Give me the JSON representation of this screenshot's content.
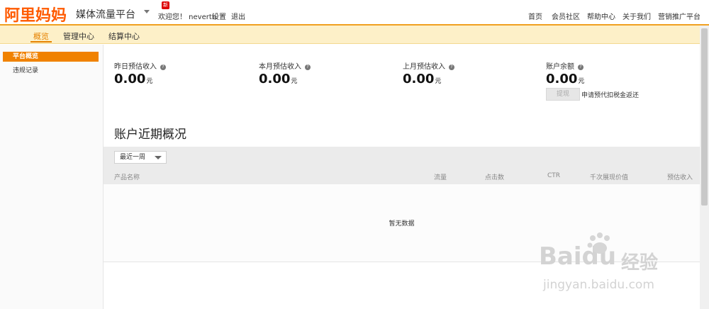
{
  "brand": {
    "logo": "阿里妈妈",
    "platform": "媒体流量平台",
    "badge": "新"
  },
  "user": {
    "welcome": "欢迎您！ neverth",
    "settings": "设置",
    "logout": "退出"
  },
  "top_links": [
    "首页",
    "会员社区",
    "帮助中心",
    "关于我们",
    "营销推广平台"
  ],
  "tabs": [
    "概览",
    "管理中心",
    "结算中心"
  ],
  "sidebar": {
    "items": [
      "平台概览",
      "违规记录"
    ]
  },
  "stats": [
    {
      "label": "昨日预估收入",
      "value": "0.00",
      "unit": "元"
    },
    {
      "label": "本月预估收入",
      "value": "0.00",
      "unit": "元"
    },
    {
      "label": "上月预估收入",
      "value": "0.00",
      "unit": "元"
    },
    {
      "label": "账户余额",
      "value": "0.00",
      "unit": "元"
    }
  ],
  "withdraw": {
    "button": "提现",
    "note": "申请预代扣税金返还"
  },
  "recent": {
    "title": "账户近期概况",
    "period": "最近一周",
    "columns": [
      "产品名称",
      "流量",
      "点击数",
      "CTR",
      "千次展现价值",
      "预估收入"
    ],
    "empty": "暂无数据"
  },
  "watermark": {
    "brand": "Baidu",
    "cn": "经验",
    "url": "jingyan.baidu.com"
  },
  "colors": {
    "accent": "#f08200",
    "logo": "#ff5a00",
    "nav_bg": "#fdf0c8"
  }
}
